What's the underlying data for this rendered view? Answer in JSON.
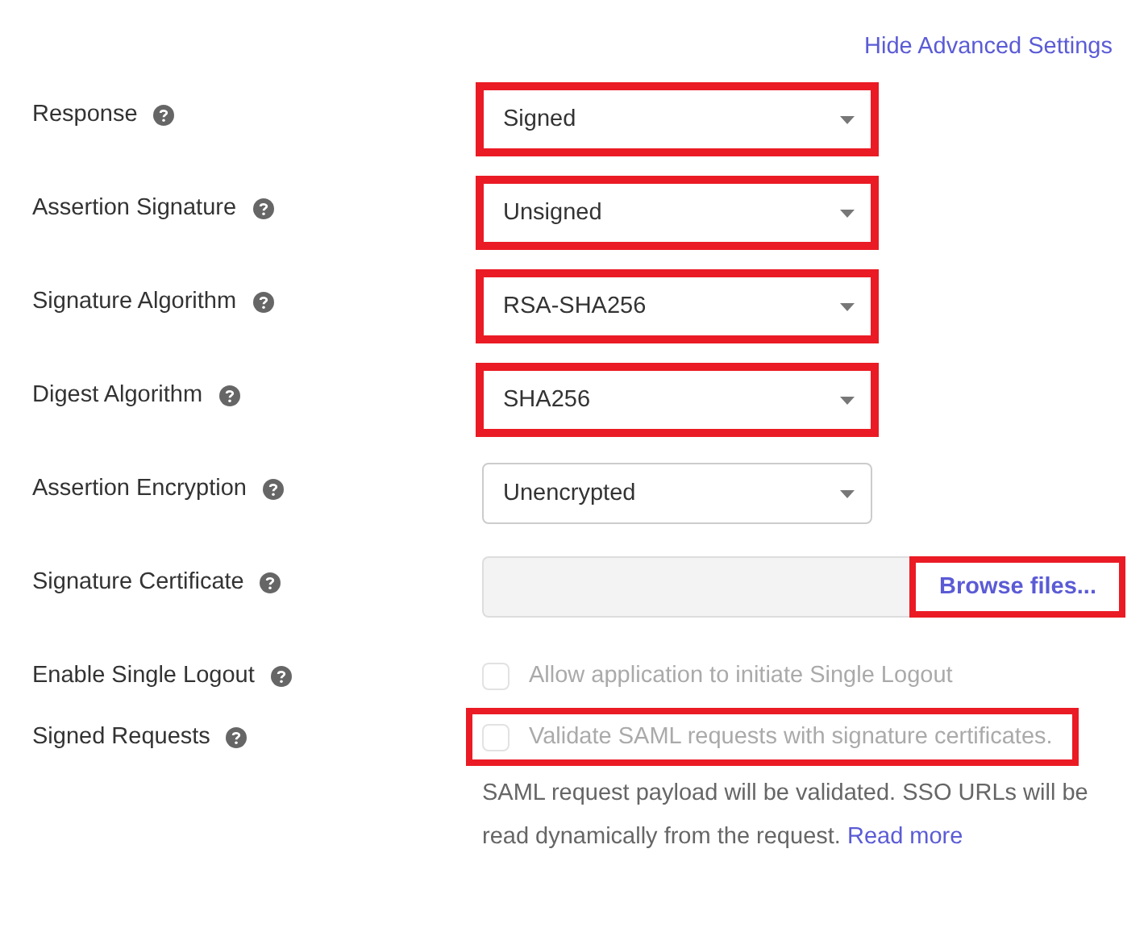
{
  "header_link": "Hide Advanced Settings",
  "rows": [
    {
      "label": "Response",
      "kind": "select",
      "value": "Signed",
      "highlighted": true
    },
    {
      "label": "Assertion Signature",
      "kind": "select",
      "value": "Unsigned",
      "highlighted": true
    },
    {
      "label": "Signature Algorithm",
      "kind": "select",
      "value": "RSA-SHA256",
      "highlighted": true
    },
    {
      "label": "Digest Algorithm",
      "kind": "select",
      "value": "SHA256",
      "highlighted": true
    },
    {
      "label": "Assertion Encryption",
      "kind": "select",
      "value": "Unencrypted",
      "highlighted": false
    },
    {
      "label": "Signature Certificate",
      "kind": "file",
      "button": "Browse files...",
      "highlighted": true
    },
    {
      "label": "Enable Single Logout",
      "kind": "checkbox",
      "text": "Allow application to initiate Single Logout",
      "checked": false,
      "disabled": true,
      "highlighted": false
    },
    {
      "label": "Signed Requests",
      "kind": "checkbox",
      "text": "Validate SAML requests with signature certificates.",
      "checked": false,
      "disabled": true,
      "highlighted": true,
      "help": "SAML request payload will be validated. SSO URLs will be read dynamically from the request.",
      "link": "Read more"
    }
  ]
}
